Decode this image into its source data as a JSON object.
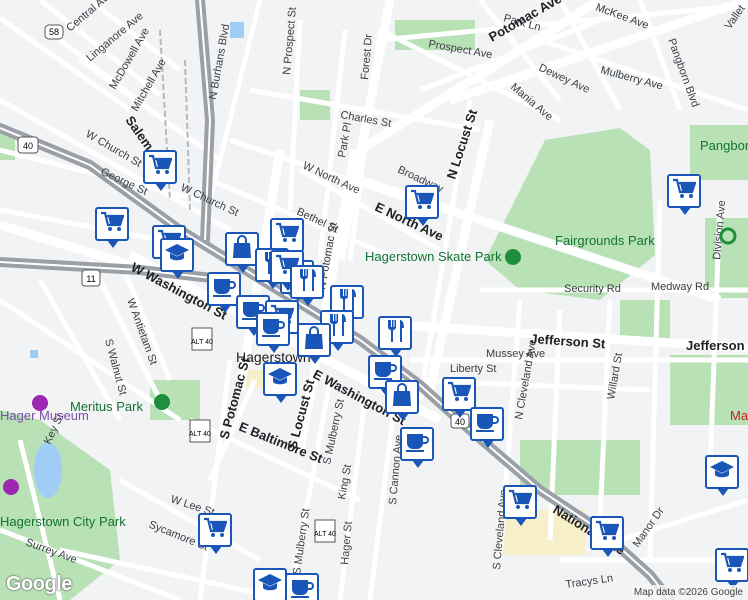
{
  "map": {
    "attribution": "Map data ©2026 Google",
    "logo": "Google",
    "colors": {
      "background": "#f2f3f5",
      "road": "#ffffff",
      "highway": "#9aa0a6",
      "park": "#b8e2b6",
      "water": "#9fcdf5",
      "pin_border": "#1a56b8",
      "pin_icon": "#1a56b8"
    },
    "streets": [
      "Central Ave",
      "Linganore Ave",
      "McDowell Ave",
      "Mitchell Ave",
      "W Church St",
      "George St",
      "N Burhans Blvd",
      "W Church St",
      "N Prospect St",
      "Forest Dr",
      "Charles St",
      "Park Pl",
      "W North Ave",
      "Bethel St",
      "N Potomac St",
      "Broadway",
      "N Locust St",
      "E North Ave",
      "Prospect Ave",
      "Park Ln",
      "Potomac Ave",
      "McKee Ave",
      "Dewey Ave",
      "Mulberry Ave",
      "Mania Ave",
      "Pangborn Blvd",
      "Security Rd",
      "Medway Rd",
      "Division Ave",
      "Jefferson St",
      "Jefferson St",
      "Mussey Ave",
      "Liberty St",
      "N Cleveland Ave",
      "Willard St",
      "W Washington St",
      "E Washington St",
      "S Walnut St",
      "W Antietam St",
      "S Potomac St",
      "S Locust St",
      "S Mulberry St",
      "E Baltimore St",
      "King St",
      "S Cannon Ave",
      "Key St",
      "Surrey Ave",
      "Sycamore St",
      "W Lee St",
      "S Mulberry St",
      "Hager St",
      "S Cleveland Ave",
      "Tracys Ln",
      "Manor Dr",
      "National Pike",
      "Salem Ave",
      "Vallet"
    ],
    "route_shields": [
      "58",
      "40",
      "11",
      "ALT 40",
      "ALT 40",
      "ALT 40",
      "40"
    ],
    "places": {
      "city": "Hagerstown",
      "skate_park": "Hagerstown Skate Park",
      "fairgrounds": "Fairgrounds Park",
      "meritus": "Meritus Park",
      "city_park": "Hagerstown City Park",
      "museum": "Hager Museum",
      "pangborn": "Pangborn",
      "institute": "Maryland Institute"
    },
    "pins": [
      {
        "name": "grocery",
        "icon": "cart"
      },
      {
        "name": "grocery",
        "icon": "cart"
      },
      {
        "name": "grocery",
        "icon": "cart"
      },
      {
        "name": "grocery",
        "icon": "cart"
      },
      {
        "name": "school",
        "icon": "mortarboard"
      },
      {
        "name": "grocery",
        "icon": "cart"
      },
      {
        "name": "shopping",
        "icon": "bag"
      },
      {
        "name": "restaurant",
        "icon": "fork-knife"
      },
      {
        "name": "cafe",
        "icon": "cup"
      },
      {
        "name": "restaurant",
        "icon": "fork-knife"
      },
      {
        "name": "grocery",
        "icon": "cart"
      },
      {
        "name": "restaurant",
        "icon": "fork-knife"
      },
      {
        "name": "cafe",
        "icon": "cup"
      },
      {
        "name": "grocery",
        "icon": "cart"
      },
      {
        "name": "restaurant",
        "icon": "fork-knife"
      },
      {
        "name": "restaurant",
        "icon": "fork-knife"
      },
      {
        "name": "cafe",
        "icon": "cup"
      },
      {
        "name": "shopping",
        "icon": "bag"
      },
      {
        "name": "school",
        "icon": "mortarboard"
      },
      {
        "name": "restaurant",
        "icon": "fork-knife"
      },
      {
        "name": "cafe",
        "icon": "cup"
      },
      {
        "name": "shopping",
        "icon": "bag"
      },
      {
        "name": "grocery",
        "icon": "cart"
      },
      {
        "name": "cafe",
        "icon": "cup"
      },
      {
        "name": "cafe",
        "icon": "cup"
      },
      {
        "name": "grocery",
        "icon": "cart"
      },
      {
        "name": "grocery",
        "icon": "cart"
      },
      {
        "name": "grocery",
        "icon": "cart"
      },
      {
        "name": "school",
        "icon": "mortarboard"
      },
      {
        "name": "grocery",
        "icon": "cart"
      },
      {
        "name": "school",
        "icon": "mortarboard"
      },
      {
        "name": "cafe",
        "icon": "cup"
      },
      {
        "name": "grocery",
        "icon": "cart"
      }
    ]
  }
}
